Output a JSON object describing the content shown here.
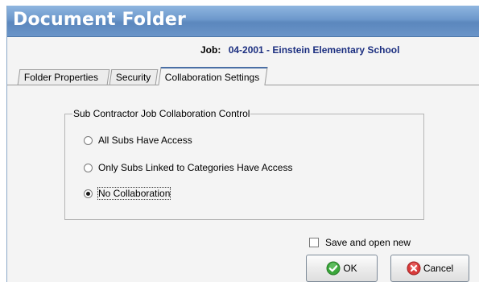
{
  "window": {
    "title": "Document Folder"
  },
  "job": {
    "label": "Job:",
    "value": "04-2001 - Einstein Elementary School"
  },
  "tabs": [
    {
      "label": "Folder Properties",
      "active": false
    },
    {
      "label": "Security",
      "active": false
    },
    {
      "label": "Collaboration Settings",
      "active": true
    }
  ],
  "collaboration": {
    "group_title": "Sub Contractor Job Collaboration Control",
    "options": [
      {
        "label": "All Subs Have Access",
        "selected": false
      },
      {
        "label": "Only Subs Linked to Categories Have Access",
        "selected": false
      },
      {
        "label": "No Collaboration",
        "selected": true
      }
    ]
  },
  "footer": {
    "save_open_new_label": "Save and open new",
    "save_open_new_checked": false,
    "ok_label": "OK",
    "cancel_label": "Cancel"
  },
  "icons": {
    "ok": "green-check-circle-icon",
    "cancel": "red-x-circle-icon"
  },
  "colors": {
    "title_bar": "#6d98cb",
    "job_value": "#1c2f80",
    "ok_icon": "#3aa63a",
    "cancel_icon": "#d83a3a"
  }
}
